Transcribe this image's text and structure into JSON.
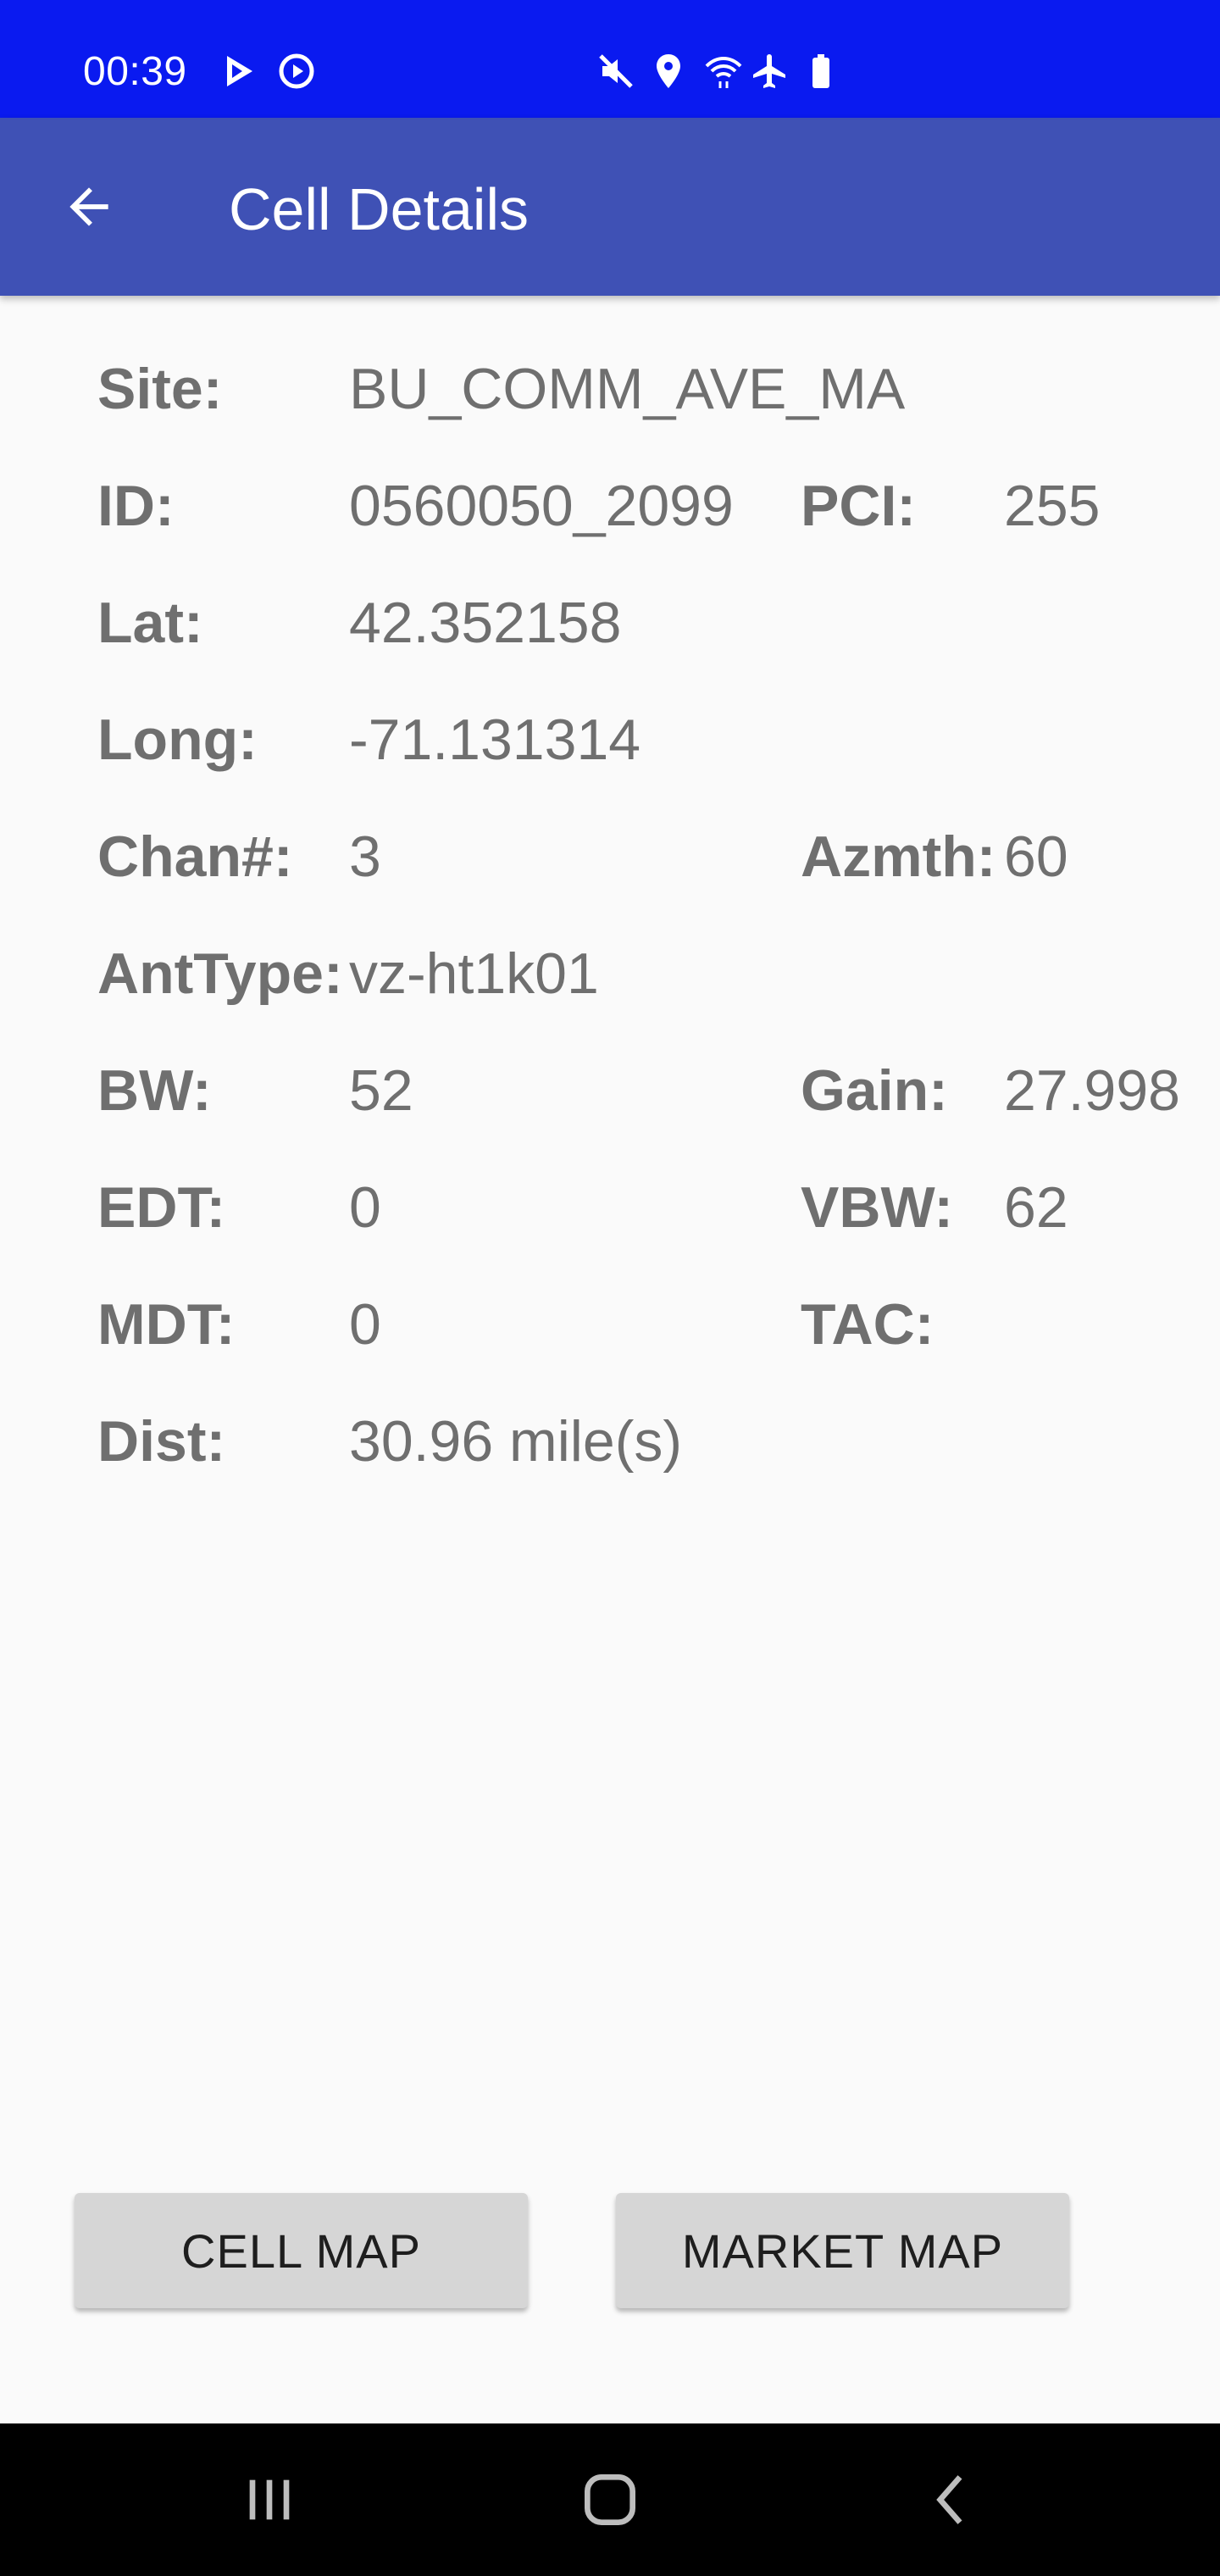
{
  "status_bar": {
    "time": "00:39",
    "icons": [
      "play-store-icon",
      "record-icon",
      "mute-icon",
      "location-icon",
      "wifi-icon",
      "airplane-icon",
      "battery-icon"
    ]
  },
  "app_bar": {
    "title": "Cell Details",
    "back_icon": "arrow-left-icon",
    "color": "#3f51b5"
  },
  "details": {
    "site_label": "Site:",
    "site_value": "BU_COMM_AVE_MA",
    "id_label": "ID:",
    "id_value": "0560050_2099",
    "pci_label": "PCI:",
    "pci_value": "255",
    "lat_label": "Lat:",
    "lat_value": "42.352158",
    "long_label": "Long:",
    "long_value": "-71.131314",
    "chan_label": "Chan#:",
    "chan_value": "3",
    "azmth_label": "Azmth:",
    "azmth_value": "60",
    "anttype_label": "AntType:",
    "anttype_value": "vz-ht1k01",
    "bw_label": "BW:",
    "bw_value": "52",
    "gain_label": "Gain:",
    "gain_value": "27.998",
    "edt_label": "EDT:",
    "edt_value": "0",
    "vbw_label": "VBW:",
    "vbw_value": "62",
    "mdt_label": "MDT:",
    "mdt_value": "0",
    "tac_label": "TAC:",
    "tac_value": "",
    "dist_label": "Dist:",
    "dist_value": "30.96 mile(s)"
  },
  "buttons": {
    "cell_map": "CELL MAP",
    "market_map": "MARKET MAP"
  },
  "nav_bar": {
    "recents_icon": "recents-icon",
    "home_icon": "home-icon",
    "back_icon": "back-icon"
  },
  "colors": {
    "status_bar": "#0a1af0",
    "app_bar": "#3f51b5",
    "background": "#fafafa",
    "text": "#6f6f6f",
    "button": "#d6d6d6",
    "nav_bar": "#000000"
  }
}
